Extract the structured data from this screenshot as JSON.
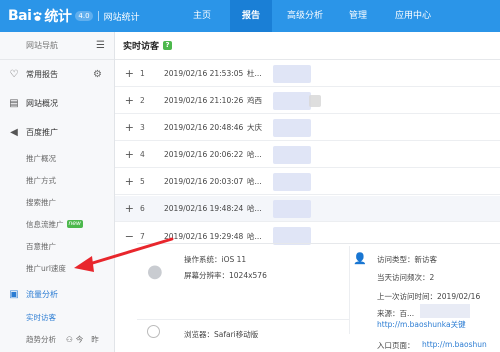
{
  "brand": {
    "logo_left": "Bai",
    "logo_right": "统计",
    "version": "4.0",
    "product": "网站统计"
  },
  "nav": {
    "items": [
      {
        "label": "主页",
        "active": false
      },
      {
        "label": "报告",
        "active": true
      },
      {
        "label": "高级分析",
        "active": false
      },
      {
        "label": "管理",
        "active": false
      },
      {
        "label": "应用中心",
        "active": false
      }
    ]
  },
  "sidebar": {
    "header": "网站导航",
    "collapse_icon": "menu-collapse-icon",
    "groups": [
      {
        "label": "常用报告",
        "icon": "heart-icon"
      },
      {
        "label": "网站概况",
        "icon": "document-icon"
      },
      {
        "label": "百度推广",
        "icon": "megaphone-icon"
      }
    ],
    "promo_items": [
      "推广概况",
      "推广方式",
      "搜索推广",
      "信息流推广",
      "百意推广",
      "推广url速度"
    ],
    "new_badge": "new",
    "traffic_group": "流量分析",
    "traffic_items": [
      "实时访客",
      "趋势分析"
    ],
    "trend_extra_1": "今",
    "trend_extra_2": "昨"
  },
  "main": {
    "title": "实时访客",
    "help": "?",
    "rows": [
      {
        "toggle": "+",
        "num": "1",
        "time": "2019/02/16 21:53:05",
        "loc": "杜..."
      },
      {
        "toggle": "+",
        "num": "2",
        "time": "2019/02/16 21:10:26",
        "loc": "鸡西"
      },
      {
        "toggle": "+",
        "num": "3",
        "time": "2019/02/16 20:48:46",
        "loc": "大庆"
      },
      {
        "toggle": "+",
        "num": "4",
        "time": "2019/02/16 20:06:22",
        "loc": "哈..."
      },
      {
        "toggle": "+",
        "num": "5",
        "time": "2019/02/16 20:03:07",
        "loc": "哈..."
      },
      {
        "toggle": "+",
        "num": "6",
        "time": "2019/02/16 19:48:24",
        "loc": "哈..."
      },
      {
        "toggle": "−",
        "num": "7",
        "time": "2019/02/16 19:29:48",
        "loc": "哈..."
      }
    ],
    "detail": {
      "os": "操作系统：iOS 11",
      "resolution": "屏幕分辨率：1024x576",
      "browser": "浏览器：Safari移动版",
      "visit_type": "访问类型：新访客",
      "visit_freq": "当天访问频次：2",
      "last_visit": "上一次访问时间：2019/02/16",
      "source_label": "来源：百...",
      "source_url": "http://m.baoshunka关键",
      "entry_label": "入口页面：",
      "entry_url": "http://m.baoshun"
    }
  },
  "colors": {
    "topbar": "#2b95e8",
    "topbar_active": "#1a7fd6",
    "accent": "#2b7cd3",
    "new_badge": "#4cb84c",
    "arrow": "#e8262c"
  }
}
